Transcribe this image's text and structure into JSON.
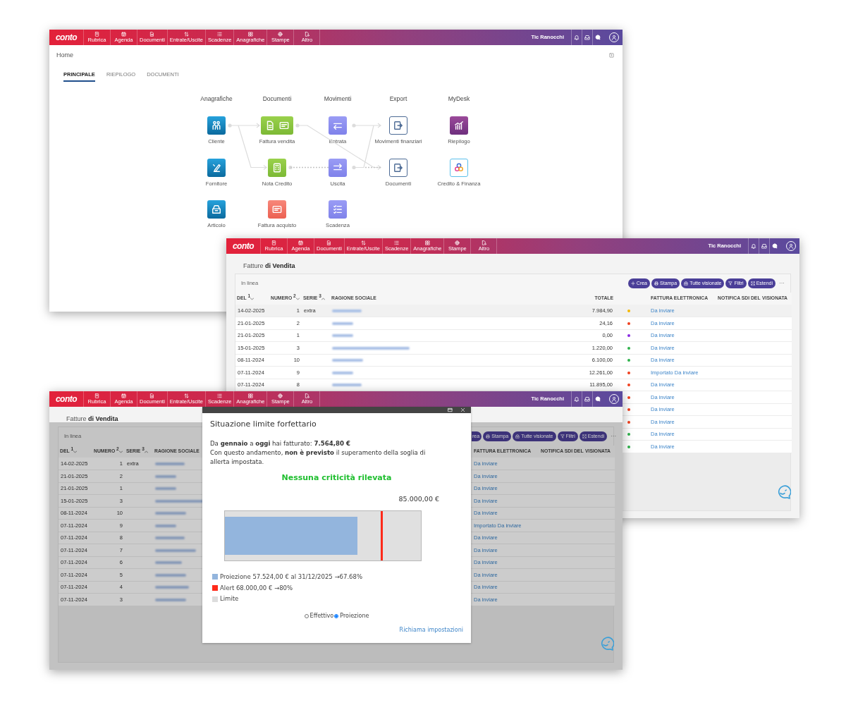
{
  "windows": [
    {
      "kind": "home",
      "navbar": {
        "logo": "conto",
        "items": [
          {
            "label": "Rubrica"
          },
          {
            "label": "Agenda"
          },
          {
            "label": "Documenti"
          },
          {
            "label": "Entrate/Uscite"
          },
          {
            "label": "Scadenze"
          },
          {
            "label": "Anagrafiche"
          },
          {
            "label": "Stampe"
          },
          {
            "label": "Altro"
          }
        ],
        "user": "Tic Ranocchi"
      },
      "title": "Home",
      "tabs": [
        {
          "label": "PRINCIPALE",
          "selected": true
        },
        {
          "label": "RIEPILOGO",
          "selected": false
        },
        {
          "label": "DOCUMENTI",
          "selected": false
        }
      ],
      "diagram": [
        {
          "heading": "Anagrafiche",
          "nodes": [
            "Cliente",
            "Fornitore",
            "Articolo"
          ]
        },
        {
          "heading": "Documenti",
          "nodes": [
            "Fattura vendita",
            "Nota Credito",
            "Fattura acquisto"
          ]
        },
        {
          "heading": "Movimenti",
          "nodes": [
            "Entrata",
            "Uscita",
            "Scadenza"
          ]
        },
        {
          "heading": "Export",
          "nodes": [
            "Movimenti finanziari",
            "Documenti"
          ]
        },
        {
          "heading": "MyDesk",
          "nodes": [
            "Riepilogo",
            "Credito & Finanza"
          ]
        }
      ]
    },
    {
      "kind": "list",
      "navbar": {
        "logo": "conto",
        "items": [
          {
            "label": "Rubrica"
          },
          {
            "label": "Agenda"
          },
          {
            "label": "Documenti"
          },
          {
            "label": "Entrate/Uscite"
          },
          {
            "label": "Scadenze"
          },
          {
            "label": "Anagrafiche"
          },
          {
            "label": "Stampe"
          },
          {
            "label": "Altro"
          }
        ],
        "user": "Tic Ranocchi"
      },
      "title": "Fatture **di Vendita**",
      "panel_label": "In linea",
      "toolbar": [
        {
          "kind": "create",
          "label": "Crea"
        },
        {
          "kind": "print",
          "label": "Stampa"
        },
        {
          "kind": "viewed",
          "label": "Tutte visionate"
        },
        {
          "kind": "filter",
          "label": "Filtri"
        },
        {
          "kind": "expand",
          "label": "Estendi"
        }
      ],
      "more": "···",
      "columns": [
        {
          "kind": "date",
          "label": "DEL",
          "sort_rank": "1",
          "sort_descending": true
        },
        {
          "kind": "number",
          "label": "NUMERO",
          "sort_rank": "2",
          "sort_descending": true
        },
        {
          "kind": "serie",
          "label": "SERIE",
          "sort_rank": "3",
          "sort_descending": false
        },
        {
          "kind": "name",
          "label": "RAGIONE SOCIALE"
        },
        {
          "kind": "total",
          "label": "TOTALE"
        },
        {
          "kind": "einvoice",
          "label": "FATTURA ELETTRONICA"
        },
        {
          "kind": "notice",
          "label": "NOTIFICA SDI DEL"
        },
        {
          "kind": "viewed",
          "label": "VISIONATA"
        }
      ],
      "rows": [
        {
          "selected": true,
          "date": "14-02-2025",
          "number": "1",
          "serie": "extra",
          "redacted": true,
          "total": "7.984,90",
          "color": "#f5b800",
          "einvoice": "Da inviare"
        },
        {
          "selected": false,
          "date": "21-01-2025",
          "number": "2",
          "redacted": true,
          "total": "24,16",
          "color": "#f0401e",
          "einvoice": "Da inviare"
        },
        {
          "selected": false,
          "date": "21-01-2025",
          "number": "1",
          "redacted": true,
          "total": "0,00",
          "color": "#8a2be2",
          "einvoice": "Da inviare"
        },
        {
          "selected": false,
          "date": "15-01-2025",
          "number": "3",
          "redacted": true,
          "total": "1.220,00",
          "color": "#2fb24c",
          "einvoice": "Da inviare"
        },
        {
          "selected": false,
          "date": "08-11-2024",
          "number": "10",
          "redacted": true,
          "total": "6.100,00",
          "color": "#2fb24c",
          "einvoice": "Da inviare"
        },
        {
          "selected": false,
          "date": "07-11-2024",
          "number": "9",
          "redacted": true,
          "total": "12.261,00",
          "color": "#f0401e",
          "einvoice": "Importato Da inviare"
        },
        {
          "selected": false,
          "date": "07-11-2024",
          "number": "8",
          "redacted": true,
          "total": "11.895,00",
          "color": "#f0401e",
          "einvoice": "Da inviare"
        },
        {
          "selected": false,
          "color": "#f0401e",
          "einvoice": "Da inviare"
        },
        {
          "selected": false,
          "color": "#f0401e",
          "einvoice": "Da inviare"
        },
        {
          "selected": false,
          "color": "#f0401e",
          "einvoice": "Da inviare"
        },
        {
          "selected": false,
          "color": "#2fb24c",
          "einvoice": "Da inviare"
        },
        {
          "selected": false,
          "color": "#2fb24c",
          "einvoice": "Da inviare"
        }
      ]
    },
    {
      "kind": "list",
      "dimmed": true,
      "navbar": {
        "logo": "conto",
        "items": [
          {
            "label": "Rubrica"
          },
          {
            "label": "Agenda"
          },
          {
            "label": "Documenti"
          },
          {
            "label": "Entrate/Uscite"
          },
          {
            "label": "Scadenze"
          },
          {
            "label": "Anagrafiche"
          },
          {
            "label": "Stampe"
          },
          {
            "label": "Altro"
          }
        ],
        "user": "Tic Ranocchi"
      },
      "title": "Fatture **di Vendita**",
      "panel_label": "In linea",
      "toolbar": [
        {
          "kind": "partial",
          "label": "rea"
        },
        {
          "kind": "print",
          "label": "Stampa"
        },
        {
          "kind": "viewed",
          "label": "Tutte visionate"
        },
        {
          "kind": "filter",
          "label": "Filtri"
        },
        {
          "kind": "expand",
          "label": "Estendi"
        }
      ],
      "more": "···",
      "columns": [
        {
          "kind": "date",
          "label": "DEL",
          "sort_rank": "1",
          "sort_descending": true
        },
        {
          "kind": "number",
          "label": "NUMERO",
          "sort_rank": "2",
          "sort_descending": true
        },
        {
          "kind": "serie",
          "label": "SERIE",
          "sort_rank": "3",
          "sort_descending": false
        },
        {
          "kind": "name",
          "label": "RAGIONE SOCIALE"
        },
        {
          "kind": "einvoice",
          "label": "FATTURA ELETTRONICA"
        },
        {
          "kind": "notice",
          "label": "NOTIFICA SDI DEL"
        },
        {
          "kind": "viewed",
          "label": "VISIONATA"
        }
      ],
      "rows": [
        {
          "selected": false,
          "date": "14-02-2025",
          "number": "1",
          "serie": "extra",
          "redacted": true,
          "einvoice": "Da inviare"
        },
        {
          "selected": false,
          "date": "21-01-2025",
          "number": "2",
          "redacted": true,
          "einvoice": "Da inviare"
        },
        {
          "selected": false,
          "date": "21-01-2025",
          "number": "1",
          "redacted": true,
          "einvoice": "Da inviare"
        },
        {
          "selected": false,
          "date": "15-01-2025",
          "number": "3",
          "redacted": true,
          "einvoice": "Da inviare"
        },
        {
          "selected": false,
          "date": "08-11-2024",
          "number": "10",
          "redacted": true,
          "einvoice": "Da inviare"
        },
        {
          "selected": false,
          "date": "07-11-2024",
          "number": "9",
          "redacted": true,
          "einvoice": "Importato Da inviare"
        },
        {
          "selected": false,
          "date": "07-11-2024",
          "number": "8",
          "redacted": true,
          "einvoice": "Da inviare"
        },
        {
          "selected": false,
          "date": "07-11-2024",
          "number": "7",
          "redacted": true,
          "einvoice": "Da inviare"
        },
        {
          "selected": false,
          "date": "07-11-2024",
          "number": "6",
          "redacted": true,
          "einvoice": "Da inviare"
        },
        {
          "selected": false,
          "date": "07-11-2024",
          "number": "5",
          "redacted": true,
          "einvoice": "Da inviare"
        },
        {
          "selected": false,
          "date": "07-11-2024",
          "number": "4",
          "redacted": true,
          "einvoice": "Da inviare"
        },
        {
          "selected": false,
          "date": "07-11-2024",
          "number": "3",
          "redacted": true,
          "einvoice": "Da inviare"
        }
      ]
    }
  ],
  "dialog": {
    "title": "Situazione limite forfettario",
    "message": [
      "Da **gennaio** a **oggi** hai fatturato: **7.564,80 €**",
      "Con questo andamento, **non è previsto** il superamento della soglia di allerta impostata."
    ],
    "status": "Nessuna criticità rilevata",
    "limit": "85.000,00 €",
    "projection": {
      "level": 0.6768
    },
    "alert": {
      "level": 0.8
    },
    "legend": [
      {
        "label": "Proiezione 57.524,00 € al 31/12/2025 →67.68%",
        "color": "#93b5dd"
      },
      {
        "label": "Alert 68.000,00 € →80%",
        "color": "#ff2a1a"
      },
      {
        "label": "Limite",
        "color": "#dddddd"
      }
    ],
    "modes": [
      {
        "label": "Effettivo",
        "selected": false
      },
      {
        "label": "Proiezione",
        "selected": true
      }
    ],
    "link": "Richiama impostazioni"
  }
}
